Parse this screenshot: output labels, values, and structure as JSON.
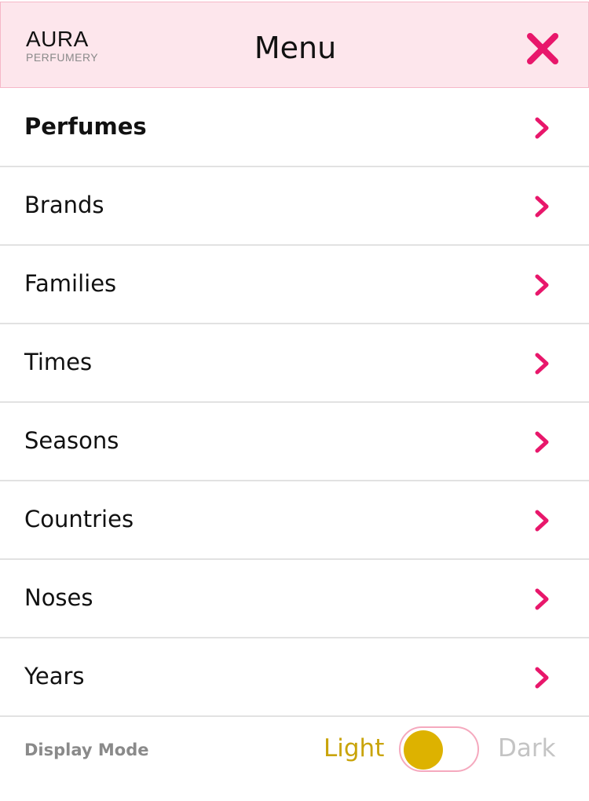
{
  "header": {
    "logo_main": "AURA",
    "logo_sub": "PERFUMERY",
    "title": "Menu",
    "close_icon": "close-icon"
  },
  "menu": {
    "items": [
      {
        "label": "Perfumes",
        "active": true
      },
      {
        "label": "Brands"
      },
      {
        "label": "Families"
      },
      {
        "label": "Times"
      },
      {
        "label": "Seasons"
      },
      {
        "label": "Countries"
      },
      {
        "label": "Noses"
      },
      {
        "label": "Years"
      }
    ],
    "chevron_icon": "chevron-right-icon"
  },
  "display_mode": {
    "label": "Display Mode",
    "light_label": "Light",
    "dark_label": "Dark",
    "current": "Light"
  },
  "colors": {
    "accent": "#e8176b",
    "header_bg": "#fde6ec",
    "toggle_knob": "#ddb200",
    "light_text": "#c9a40a"
  }
}
